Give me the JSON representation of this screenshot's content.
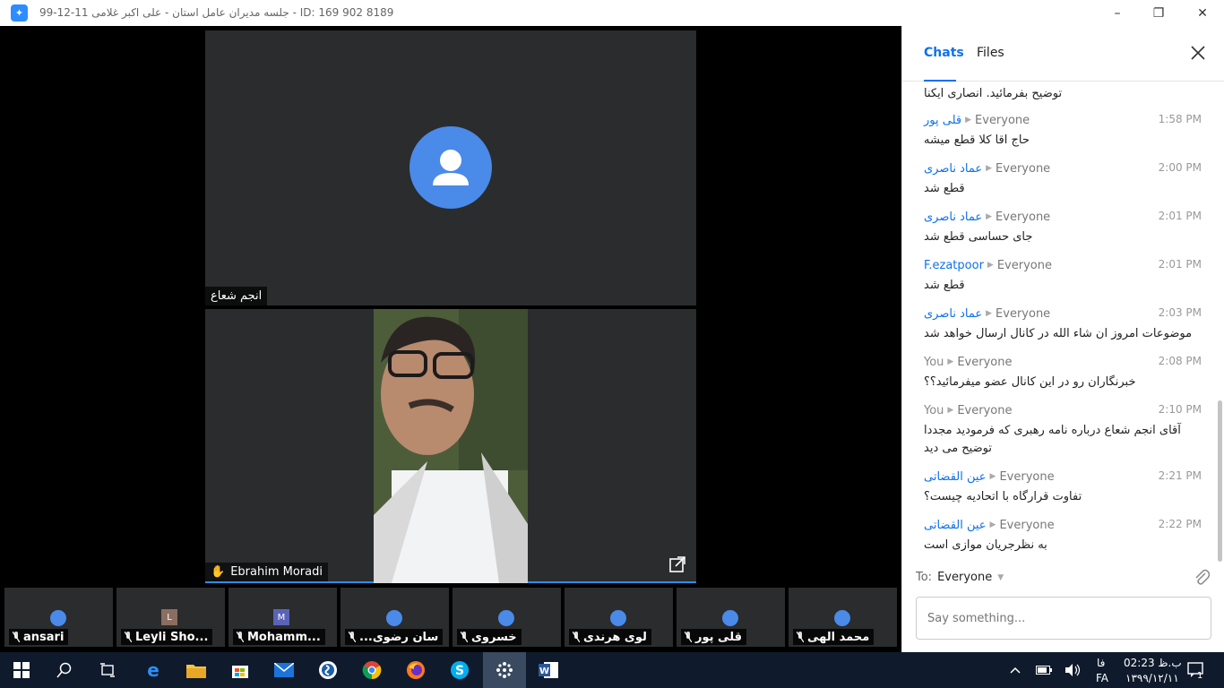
{
  "window": {
    "title": "99-12-11 جلسه مدیران عامل استان - علی اکبر غلامی - ID: 169 902 8189"
  },
  "video": {
    "top_tile_name": "انجم شعاع",
    "bottom_tile_name": "Ebrahim Moradi"
  },
  "thumbnails": [
    {
      "name": "ansari",
      "letter": ""
    },
    {
      "name": "Leyli Sho...",
      "letter": "L"
    },
    {
      "name": "Mohamm...",
      "letter": "M"
    },
    {
      "name": "...سان رضوی",
      "letter": ""
    },
    {
      "name": "خسروی",
      "letter": ""
    },
    {
      "name": "لوی هرندی",
      "letter": ""
    },
    {
      "name": "قلی پور",
      "letter": ""
    },
    {
      "name": "محمد الهی",
      "letter": ""
    }
  ],
  "chat": {
    "tab_chats": "Chats",
    "tab_files": "Files",
    "messages": [
      {
        "sender": "",
        "to": "",
        "time": "",
        "text": "توضیح بفرمائید. انصاری ایکنا"
      },
      {
        "sender": "قلی پور",
        "to": "Everyone",
        "time": "1:58 PM",
        "text": "حاج اقا کلا قطع میشه"
      },
      {
        "sender": "عماد ناصری",
        "to": "Everyone",
        "time": "2:00 PM",
        "text": "قطع شد"
      },
      {
        "sender": "عماد ناصری",
        "to": "Everyone",
        "time": "2:01 PM",
        "text": "جای حساسی قطع شد"
      },
      {
        "sender": "F.ezatpoor",
        "to": "Everyone",
        "time": "2:01 PM",
        "text": "قطع شد"
      },
      {
        "sender": "عماد ناصری",
        "to": "Everyone",
        "time": "2:03 PM",
        "text": "موضوعات امروز ان شاء الله در کانال ارسال خواهد شد"
      },
      {
        "sender": "You",
        "to": "Everyone",
        "time": "2:08 PM",
        "text": "خبرنگاران رو در این کانال عضو میفرمائید؟؟"
      },
      {
        "sender": "You",
        "to": "Everyone",
        "time": "2:10 PM",
        "text": "آقای انجم شعاع درباره نامه رهبری که فرمودید مجددا توضیح می دید"
      },
      {
        "sender": "عین القضاتی",
        "to": "Everyone",
        "time": "2:21 PM",
        "text": "تفاوت قرارگاه با اتحادیه چیست؟"
      },
      {
        "sender": "عین القضاتی",
        "to": "Everyone",
        "time": "2:22 PM",
        "text": "به نظرجریان موازی است"
      }
    ],
    "to_label": "To:",
    "to_value": "Everyone",
    "input_placeholder": "Say something..."
  },
  "taskbar": {
    "time": "02:23 ب.ظ",
    "date": "۱۳۹۹/۱۲/۱۱",
    "lang_top": "فا",
    "lang_bottom": "FA",
    "notifications": "1"
  }
}
